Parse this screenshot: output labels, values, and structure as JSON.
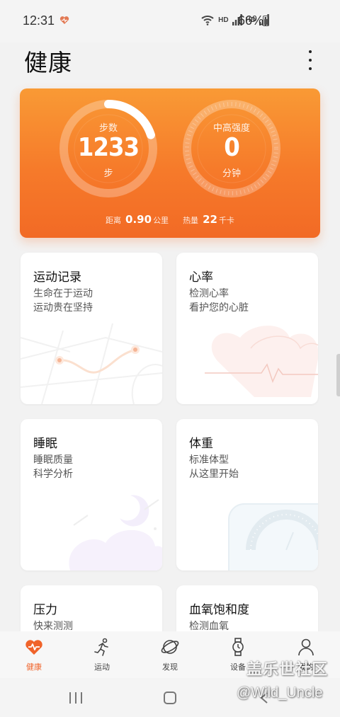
{
  "status_bar": {
    "time": "12:31",
    "network_label_1": "HD",
    "network_label_2": "HD",
    "battery": "66%"
  },
  "header": {
    "title": "健康"
  },
  "summary": {
    "steps_label": "步数",
    "steps_value": "1233",
    "steps_unit": "步",
    "steps_progress": 0.2,
    "intensity_label": "中高强度",
    "intensity_value": "0",
    "intensity_unit": "分钟",
    "distance_label": "距离",
    "distance_value": "0.90",
    "distance_unit": "公里",
    "calories_label": "热量",
    "calories_value": "22",
    "calories_unit": "千卡"
  },
  "tiles": {
    "exercise": {
      "title": "运动记录",
      "line1": "生命在于运动",
      "line2": "运动贵在坚持"
    },
    "heart": {
      "title": "心率",
      "line1": "检测心率",
      "line2": "看护您的心脏"
    },
    "sleep": {
      "title": "睡眠",
      "line1": "睡眠质量",
      "line2": "科学分析"
    },
    "weight": {
      "title": "体重",
      "line1": "标准体型",
      "line2": "从这里开始"
    },
    "stress": {
      "title": "压力",
      "line1": "快来测测"
    },
    "spo2": {
      "title": "血氧饱和度",
      "line1": "检测血氧"
    }
  },
  "nav": {
    "items": [
      {
        "label": "健康",
        "icon": "heart-pulse-icon"
      },
      {
        "label": "运动",
        "icon": "running-icon"
      },
      {
        "label": "发现",
        "icon": "planet-icon"
      },
      {
        "label": "设备",
        "icon": "watch-icon"
      },
      {
        "label": "我的",
        "icon": "person-icon"
      }
    ]
  },
  "watermark": {
    "line1": "盖乐世社区",
    "line2": "@Wild_Uncle"
  },
  "colors": {
    "accent": "#f0632a",
    "card_top": "#f99a35",
    "card_bottom": "#f26a25"
  }
}
